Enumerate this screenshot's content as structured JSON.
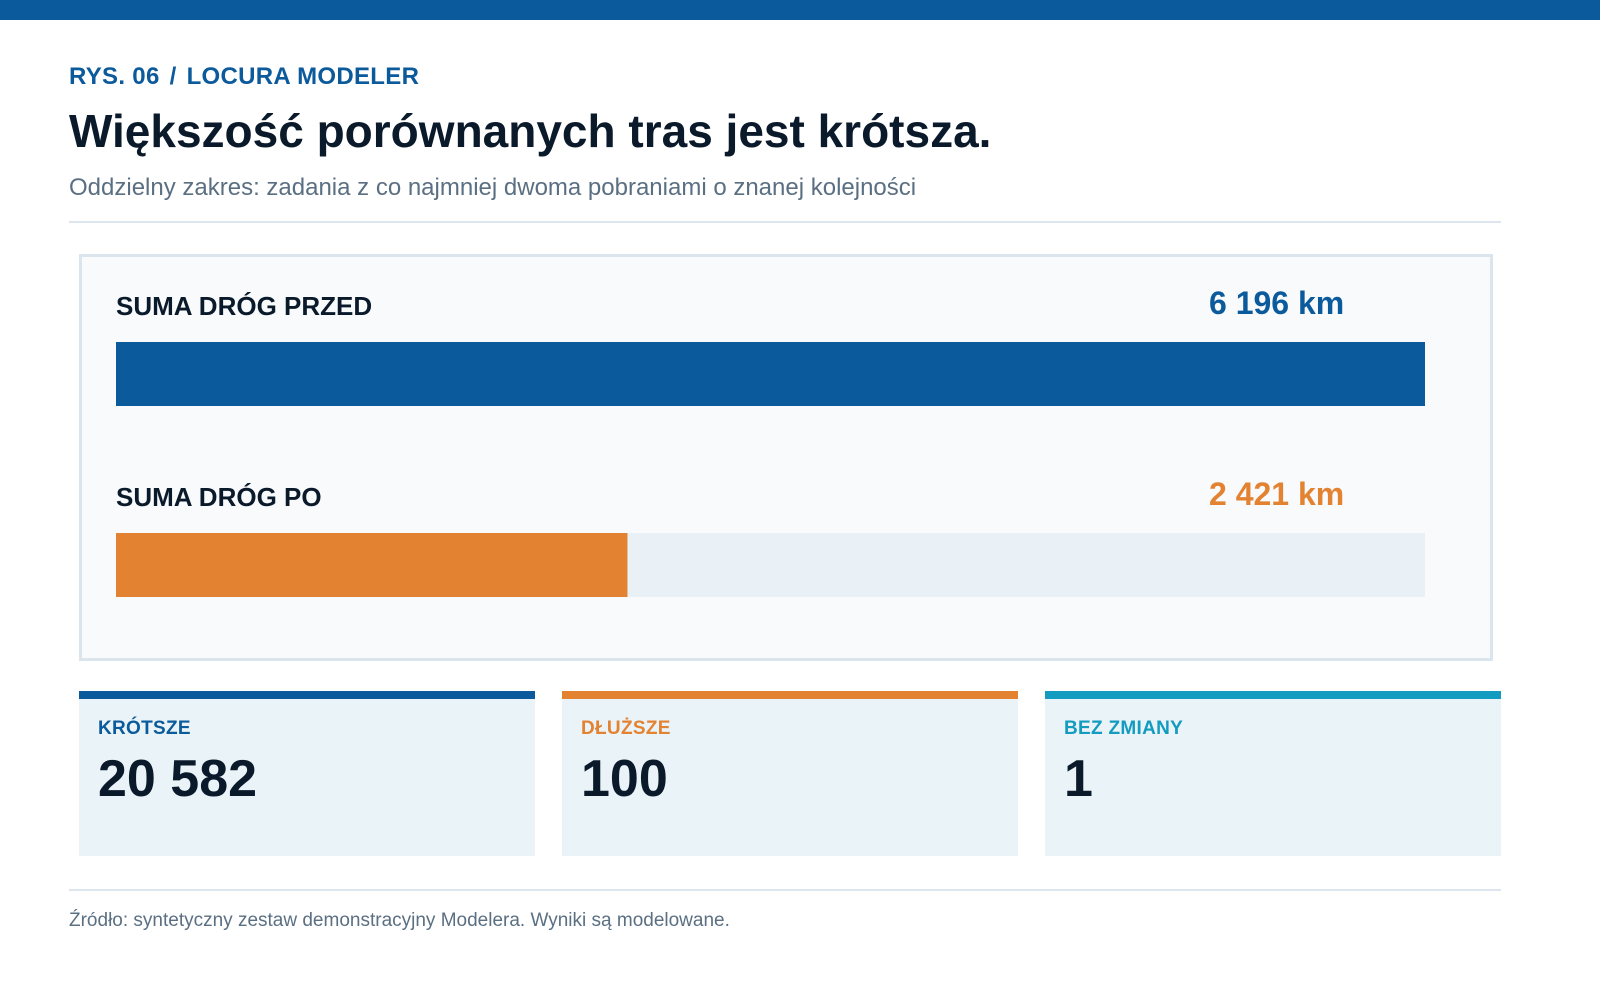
{
  "header": {
    "kicker_figure": "RYS. 06",
    "kicker_separator": "/",
    "kicker_product": "LOCURA MODELER",
    "title": "Większość porównanych tras jest krótsza.",
    "subtitle": "Oddzielny zakres: zadania z co najmniej dwoma pobraniami o znanej kolejności"
  },
  "chart_data": {
    "type": "bar",
    "orientation": "horizontal",
    "title": "",
    "xlabel": "",
    "ylabel": "",
    "unit": "km",
    "xlim": [
      0,
      6196
    ],
    "grid": false,
    "legend": "none",
    "bars": [
      {
        "label": "SUMA DRÓG PRZED",
        "value": 6196,
        "display": "6 196 km",
        "color": "#0b5a9b"
      },
      {
        "label": "SUMA DRÓG PO",
        "value": 2421,
        "display": "2 421 km",
        "color": "#e38332"
      }
    ]
  },
  "stats": [
    {
      "label": "KRÓTSZE",
      "value": "20 582",
      "color": "#0b5a9b"
    },
    {
      "label": "DŁUŻSZE",
      "value": "100",
      "color": "#e38332"
    },
    {
      "label": "BEZ ZMIANY",
      "value": "1",
      "color": "#139bc0"
    }
  ],
  "colors": {
    "brand": "#0b5a9b",
    "after": "#e38332",
    "unchanged": "#139bc0",
    "track": "#e9f1f7"
  },
  "footer": {
    "source": "Źródło: syntetyczny zestaw demonstracyjny Modelera. Wyniki są modelowane."
  }
}
